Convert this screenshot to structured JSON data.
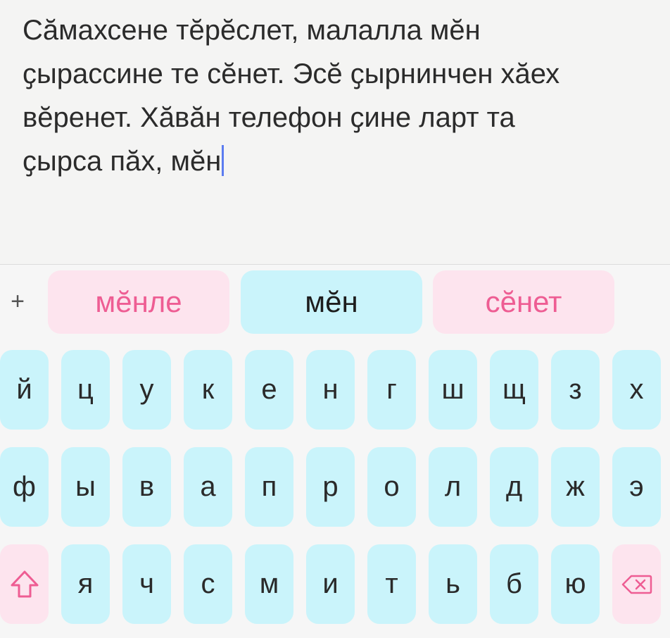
{
  "editor": {
    "lines": [
      "Сӑмахсене тӗрӗслет, малалла мӗн",
      "ҫырассине те сӗнет. Эсӗ ҫырнинчен хӑех",
      "вӗренет. Хӑвӑн телефон ҫине ларт та",
      "ҫырса пӑх, мӗн"
    ]
  },
  "suggestion_bar": {
    "plus_label": "+",
    "suggestions": [
      "мӗнле",
      "мӗн",
      "сӗнет"
    ]
  },
  "keyboard": {
    "row1": [
      "й",
      "ц",
      "у",
      "к",
      "е",
      "н",
      "г",
      "ш",
      "щ",
      "з",
      "х"
    ],
    "row2": [
      "ф",
      "ы",
      "в",
      "а",
      "п",
      "р",
      "о",
      "л",
      "д",
      "ж",
      "э"
    ],
    "row3": [
      "я",
      "ч",
      "с",
      "м",
      "и",
      "т",
      "ь",
      "б",
      "ю"
    ],
    "shift_icon": "shift-arrow-icon",
    "backspace_icon": "backspace-icon"
  },
  "colors": {
    "key_blue": "#caf4fb",
    "key_pink": "#fde4ee",
    "suggestion_pink_text": "#ee5d93",
    "caret": "#5b7cf0"
  }
}
